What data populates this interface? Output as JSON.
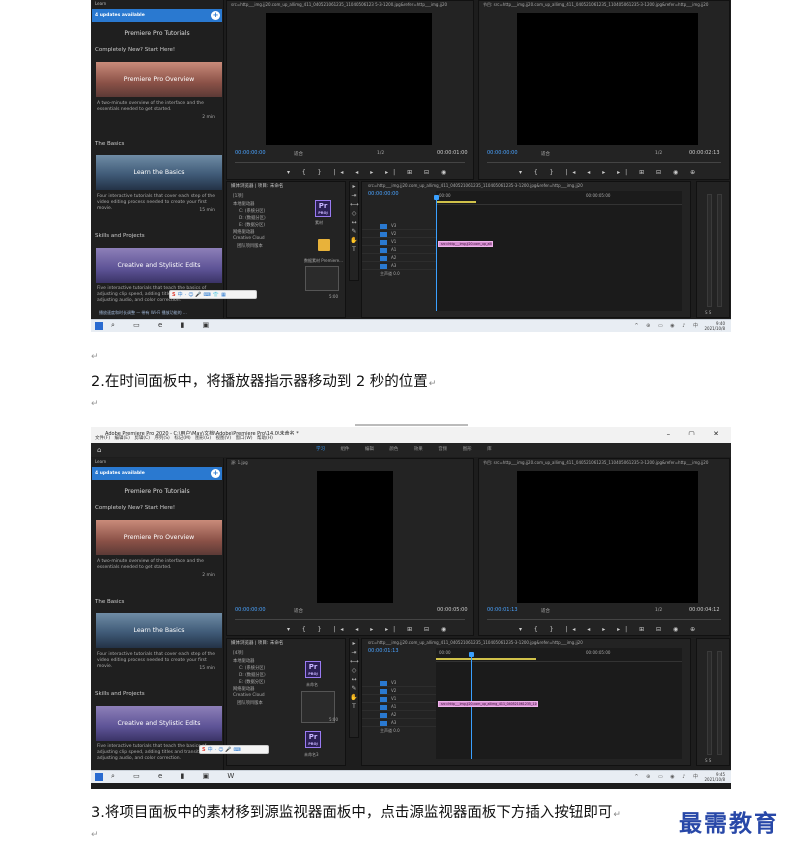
{
  "paragraph_mark": "↵",
  "step2_text": "2.在时间面板中，将播放器指示器移动到 2 秒的位置",
  "step3_text": "3.将项目面板中的素材移到源监视器面板中，点击源监视器面板下方插入按钮即可",
  "watermark": "最需教育",
  "learn_panel": {
    "header": "Learn",
    "updates_label": "4 updates available",
    "title": "Premiere Pro Tutorials",
    "section1": "Completely New? Start Here!",
    "card1_title": "Premiere Pro Overview",
    "card1_desc": "A two-minute overview of the interface and the essentials needed to get started.",
    "card1_dur": "2 min",
    "section2": "The Basics",
    "card2_title": "Learn the Basics",
    "card2_desc": "Four interactive tutorials that cover each step of the video editing process needed to create your first movie.",
    "card2_dur": "15 min",
    "section3": "Skills and Projects",
    "card3_title": "Creative and Stylistic Edits",
    "card3_desc": "Five interactive tutorials that teach the basics of adjusting clip speed, adding titles and transitions, adjusting audio, and color correction."
  },
  "shot1": {
    "source_title": "src=http___img.jj20.com_up_allimg_411_040521061235_11040506123 5-3-1200.jpg&refer=http___img.jj20",
    "program_title": "节目: src=http___img.jj20.com_up_allimg_411_040521061235_110405061235-3-1200.jpg&refer=http___img.jj20",
    "source_tc": "00:00:00:00",
    "source_fit": "适合",
    "source_page": "1/2",
    "source_dur": "00:00:01:00",
    "program_tc": "00:00:00:00",
    "program_fit": "适合",
    "program_page": "1/2",
    "program_dur": "00:00:02:13",
    "project_tab": "媒体浏览器",
    "project_tab2": "项目: 未命名",
    "project_filter": "[1项]",
    "tree": [
      "本地驱动器",
      "C: (系统分区)",
      "D: (数据分区)",
      "E: (数据分区)",
      "网络驱动器",
      "Creative Cloud",
      "团队项目版本"
    ],
    "tile_label_pr": "素材",
    "tile_label_img": "数据素材 Premiere...",
    "tile_dur": "5:00",
    "seq_title": "src=http___img.jj20.com_up_allimg_411_040521061235_110405061235-3-1200.jpg&refer=http___img.jj20",
    "seq_tc": "00:00:00:00",
    "ruler_start": "00:00",
    "ruler_mid": "00:00:05:00",
    "clip_label": "src=http___img.jj20.com_up_allimg",
    "tracks": [
      "V3",
      "V2",
      "V1",
      "A1",
      "A2",
      "A3"
    ],
    "master": "主声道",
    "master_val": "0.0",
    "bottom_tabs": "播放速度和时长调整 — 带有 Wi-Fi 播放功能的 ...",
    "clock_time": "9:40",
    "clock_date": "2021/10/8"
  },
  "shot2": {
    "app_title": "Adobe Premiere Pro 2020 - C:\\用户\\May\\文档\\Adobe\\Premiere Pro\\14.0\\未命名 *",
    "menu": [
      "文件(F)",
      "编辑(E)",
      "剪辑(C)",
      "序列(S)",
      "标记(M)",
      "图形(G)",
      "视图(V)",
      "窗口(W)",
      "帮助(H)"
    ],
    "workspaces": [
      "学习",
      "组件",
      "编辑",
      "颜色",
      "效果",
      "音频",
      "图形",
      "库"
    ],
    "source_title": "源: 1.jpg",
    "program_title": "节目: src=http___img.jj20.com_up_allimg_411_040521061235_110405061235-3-1200.jpg&refer=http___img.jj20",
    "source_tc": "00:00:00:00",
    "source_fit": "适合",
    "source_dur": "00:00:05:00",
    "program_tc": "00:00:01:13",
    "program_fit": "适合",
    "program_page": "1/2",
    "program_dur": "00:00:04:12",
    "project_tab": "媒体浏览器",
    "project_tab2": "项目: 未命名",
    "project_filter": "[4项]",
    "tree": [
      "本地驱动器",
      "C: (系统分区)",
      "D: (数据分区)",
      "E: (数据分区)",
      "网络驱动器",
      "Creative Cloud",
      "团队项目版本"
    ],
    "tile_label_pr": "未命名",
    "tile_dur": "5:00",
    "tile_label_pr2": "未命名3",
    "seq_title": "src=http___img.jj20.com_up_allimg_411_040521061235_110405061235-3-1200.jpg&refer=http___img.jj20",
    "seq_tc": "00:00:01:13",
    "ruler_start": "00:00",
    "ruler_mid": "00:00:05:00",
    "clip_label": "src=http___img.jj20.com_up_allimg_411_040521061235_110405",
    "tracks": [
      "V3",
      "V2",
      "V1",
      "A1",
      "A2",
      "A3"
    ],
    "master": "主声道",
    "master_val": "0.0",
    "clock_time": "9:45",
    "clock_date": "2021/10/8"
  }
}
